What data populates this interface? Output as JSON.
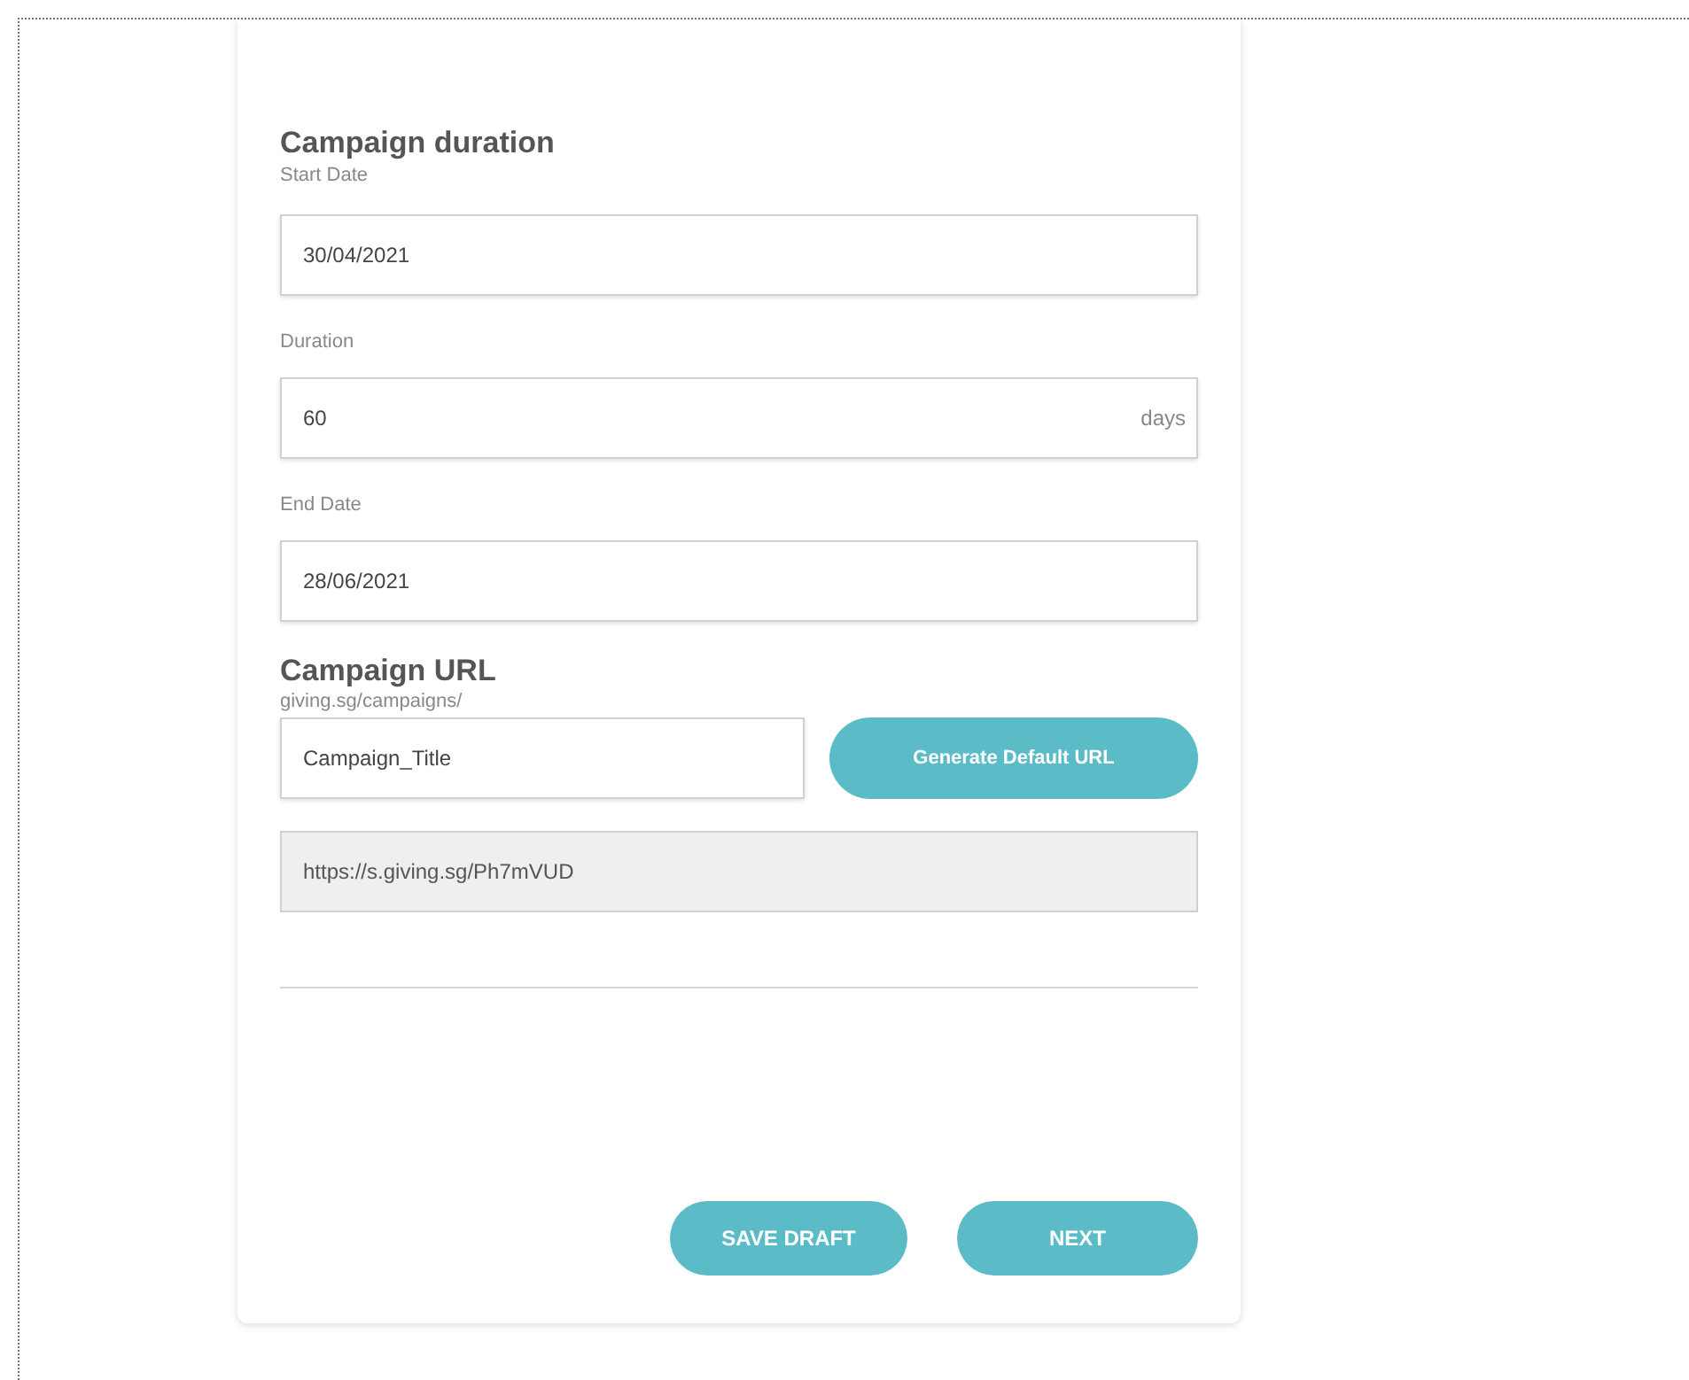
{
  "duration_section": {
    "title": "Campaign duration",
    "fields": [
      {
        "kind": "text",
        "label": "Start Date",
        "value": "30/04/2021"
      },
      {
        "kind": "suffix",
        "label": "Duration",
        "value": "60",
        "suffix": "days"
      },
      {
        "kind": "text",
        "label": "End Date",
        "value": "28/06/2021"
      }
    ]
  },
  "url_section": {
    "title": "Campaign URL",
    "prefix": "giving.sg/campaigns/",
    "slug": "Campaign_Title",
    "generate_button": "Generate Default URL",
    "short_url": "https://s.giving.sg/Ph7mVUD"
  },
  "buttons": [
    "SAVE DRAFT",
    "NEXT"
  ]
}
